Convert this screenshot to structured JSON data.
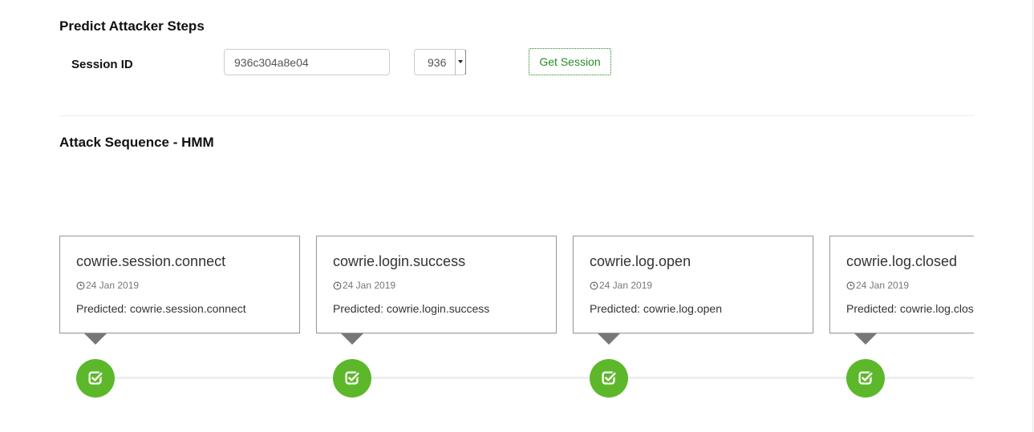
{
  "header": {
    "title": "Predict Attacker Steps"
  },
  "session_form": {
    "label": "Session ID",
    "input_value": "936c304a8e04",
    "select_value": "936",
    "button_label": "Get Session"
  },
  "sequence": {
    "title": "Attack Sequence - HMM",
    "events": [
      {
        "name": "cowrie.session.connect",
        "date": "24 Jan 2019",
        "predicted": "Predicted: cowrie.session.connect",
        "icon": "check-square-icon"
      },
      {
        "name": "cowrie.login.success",
        "date": "24 Jan 2019",
        "predicted": "Predicted: cowrie.login.success",
        "icon": "check-square-icon"
      },
      {
        "name": "cowrie.log.open",
        "date": "24 Jan 2019",
        "predicted": "Predicted: cowrie.log.open",
        "icon": "check-square-icon"
      },
      {
        "name": "cowrie.log.closed",
        "date": "24 Jan 2019",
        "predicted": "Predicted: cowrie.log.closed",
        "icon": "check-square-icon"
      }
    ]
  },
  "colors": {
    "badge": "#5cb82a",
    "button_text": "#2a8a2a"
  }
}
